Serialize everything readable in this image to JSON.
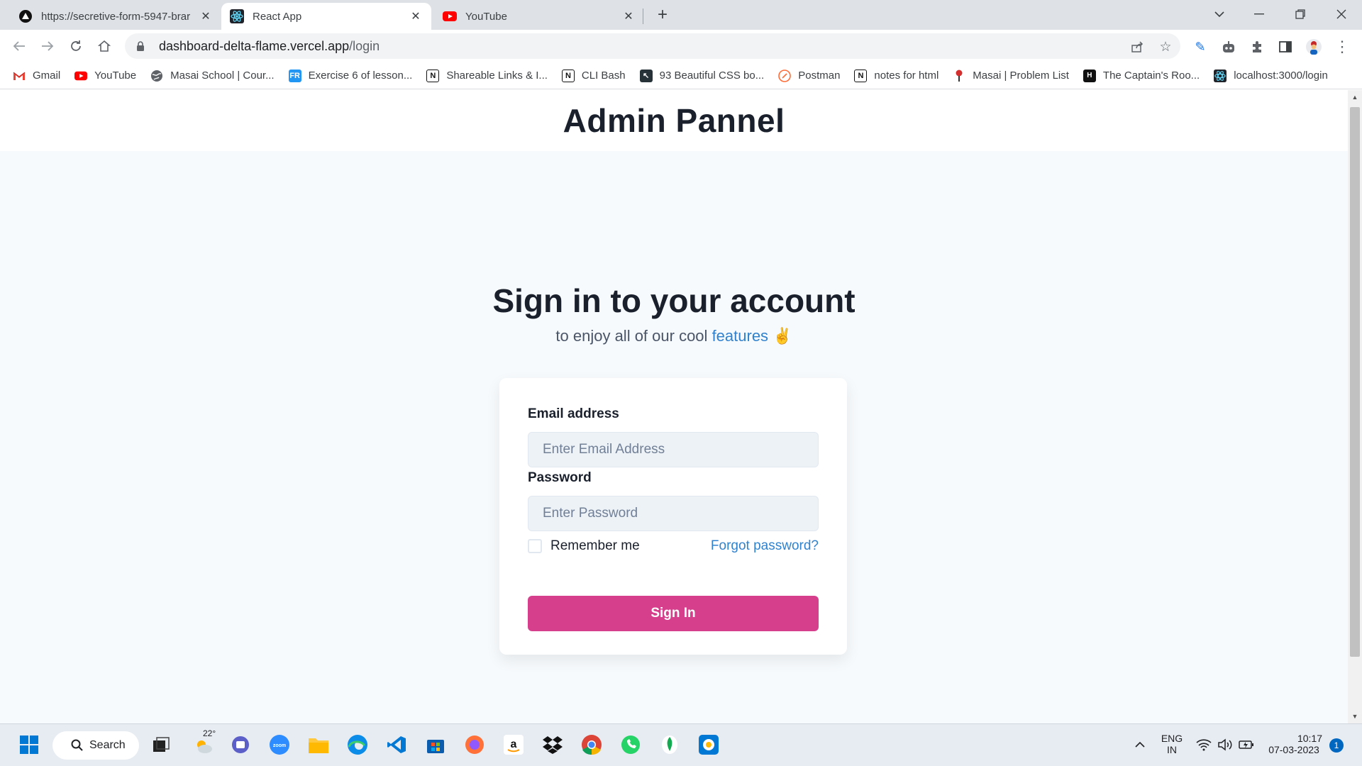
{
  "browser": {
    "tabs": [
      {
        "title": "https://secretive-form-5947-brar",
        "active": false
      },
      {
        "title": "React App",
        "active": true
      },
      {
        "title": "YouTube",
        "active": false
      }
    ],
    "url_host": "dashboard-delta-flame.vercel.app",
    "url_path": "/login",
    "bookmarks": [
      {
        "label": "Gmail",
        "icon": "gmail-icon"
      },
      {
        "label": "YouTube",
        "icon": "youtube-icon"
      },
      {
        "label": "Masai School | Cour...",
        "icon": "globe-icon"
      },
      {
        "label": "Exercise 6 of lesson...",
        "icon": "typing-icon"
      },
      {
        "label": "Shareable Links & I...",
        "icon": "notion-icon"
      },
      {
        "label": "CLI Bash",
        "icon": "notion-icon"
      },
      {
        "label": "93 Beautiful CSS bo...",
        "icon": "cursor-icon"
      },
      {
        "label": "Postman",
        "icon": "postman-icon"
      },
      {
        "label": "notes for html",
        "icon": "notion-icon"
      },
      {
        "label": "Masai | Problem List",
        "icon": "masai-icon"
      },
      {
        "label": "The Captain's Roo...",
        "icon": "hackerrank-icon"
      },
      {
        "label": "localhost:3000/login",
        "icon": "react-icon"
      }
    ]
  },
  "page": {
    "header_title": "Admin Pannel",
    "heading": "Sign in to your account",
    "subtitle_prefix": "to enjoy all of our cool",
    "subtitle_link": "features",
    "subtitle_emoji": "✌️",
    "email_label": "Email address",
    "email_placeholder": "Enter Email Address",
    "password_label": "Password",
    "password_placeholder": "Enter Password",
    "remember_label": "Remember me",
    "forgot_label": "Forgot password?",
    "signin_label": "Sign In"
  },
  "taskbar": {
    "search_label": "Search",
    "weather_temp": "22°",
    "language_top": "ENG",
    "language_bottom": "IN",
    "time": "10:17",
    "date": "07-03-2023",
    "notification_count": "1"
  },
  "colors": {
    "accent_pink": "#d53f8c",
    "link_blue": "#3182ce",
    "page_bg": "#f7fafc"
  }
}
